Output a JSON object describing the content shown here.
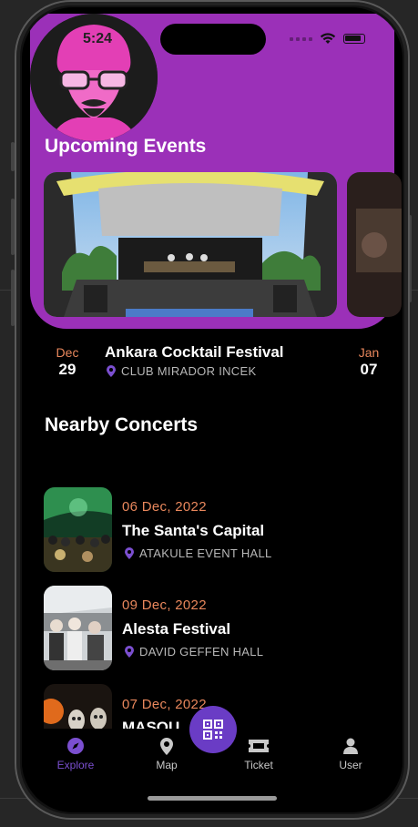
{
  "status_bar": {
    "time": "5:24"
  },
  "upcoming": {
    "title": "Upcoming Events",
    "featured": {
      "month": "Dec",
      "day": "29",
      "name": "Ankara Cocktail Festival",
      "venue": "CLUB MIRADOR INCEK"
    },
    "next": {
      "month": "Jan",
      "day": "07"
    }
  },
  "nearby": {
    "title": "Nearby Concerts",
    "items": [
      {
        "date": "06 Dec, 2022",
        "name": "The Santa's Capital",
        "venue": "ATAKULE EVENT HALL"
      },
      {
        "date": "09 Dec, 2022",
        "name": "Alesta Festival",
        "venue": "DAVID GEFFEN HALL"
      },
      {
        "date": "07 Dec, 2022",
        "name": "MASQU"
      }
    ]
  },
  "nav": {
    "items": [
      {
        "label": "Explore",
        "icon": "compass-icon",
        "active": true
      },
      {
        "label": "Map",
        "icon": "map-pin-icon"
      },
      {
        "label": "Ticket",
        "icon": "ticket-icon"
      },
      {
        "label": "User",
        "icon": "user-icon"
      }
    ],
    "fab_icon": "qr-code-icon"
  },
  "colors": {
    "header_purple": "#9b30b8",
    "accent_orange": "#e8875c",
    "nav_active": "#7b4fd0",
    "fab": "#6a3cc5"
  }
}
